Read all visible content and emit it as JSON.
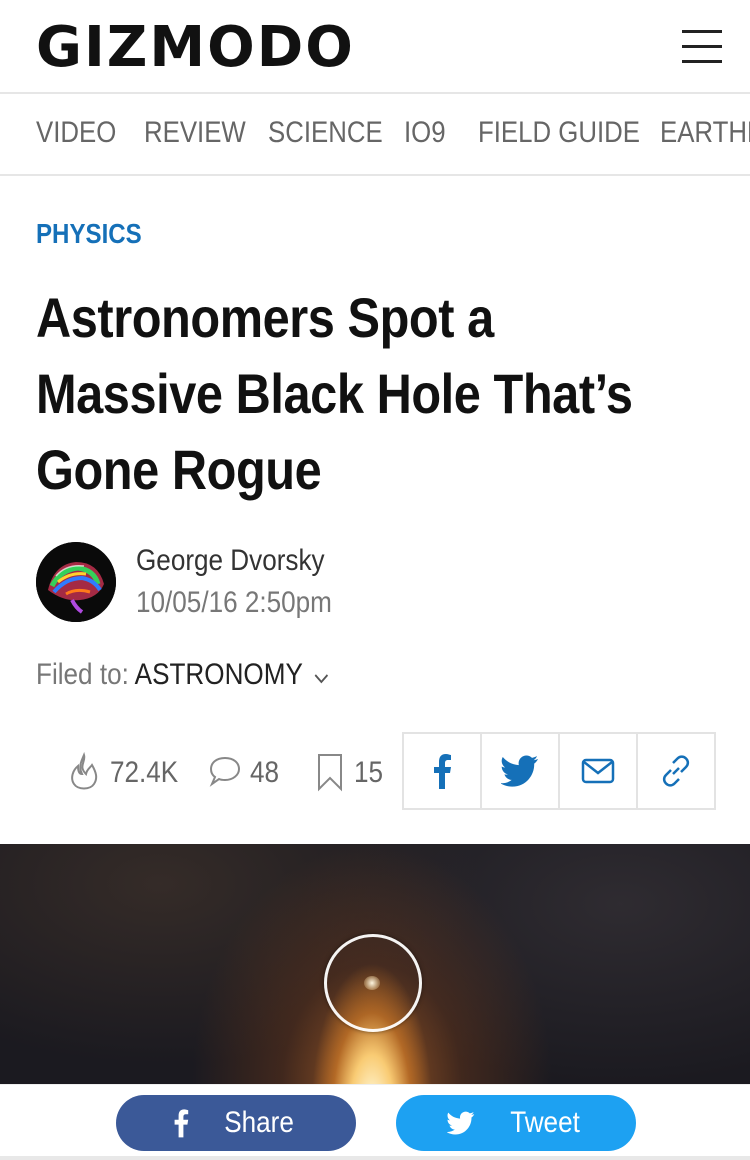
{
  "site": {
    "logo": "GIZMODO"
  },
  "nav": {
    "sections": [
      "VIDEO",
      "REVIEW",
      "SCIENCE",
      "IO9",
      "FIELD GUIDE",
      "EARTHER"
    ]
  },
  "article": {
    "kicker": "PHYSICS",
    "headline_lines": [
      "Astronomers Spot a",
      "Massive Black Hole That’s",
      "Gone Rogue"
    ],
    "author": "George Dvorsky",
    "timestamp": "10/05/16 2:50pm",
    "filed_label": "Filed to:",
    "filed_tag": "ASTRONOMY"
  },
  "stats": {
    "views": "72.4K",
    "comments": "48",
    "bookmarks": "15"
  },
  "share_icons": [
    "facebook-icon",
    "twitter-icon",
    "email-icon",
    "link-icon"
  ],
  "bottom_bar": {
    "share_label": "Share",
    "tweet_label": "Tweet"
  },
  "colors": {
    "accent_blue": "#1570b8",
    "facebook": "#3b5998",
    "twitter": "#1da1f2"
  }
}
